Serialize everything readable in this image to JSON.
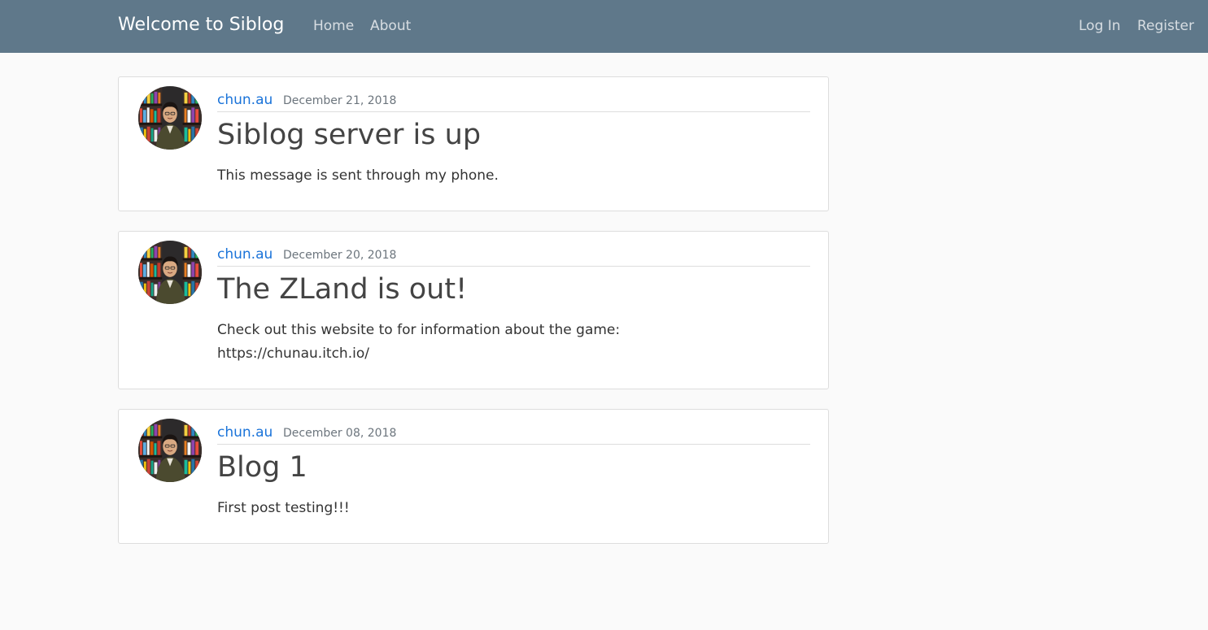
{
  "navbar": {
    "brand": "Welcome to Siblog",
    "links": {
      "home": "Home",
      "about": "About"
    },
    "auth": {
      "login": "Log In",
      "register": "Register"
    }
  },
  "colors": {
    "navbar_bg": "#5f788a",
    "link": "#1a73d9",
    "page_bg": "#fafafa"
  },
  "posts": [
    {
      "author": "chun.au",
      "date": "December 21, 2018",
      "title": "Siblog server is up",
      "content": "This message is sent through my phone."
    },
    {
      "author": "chun.au",
      "date": "December 20, 2018",
      "title": "The ZLand is out!",
      "content": "Check out this website to for information about the game:\nhttps://chunau.itch.io/"
    },
    {
      "author": "chun.au",
      "date": "December 08, 2018",
      "title": "Blog 1",
      "content": "First post testing!!!"
    }
  ]
}
